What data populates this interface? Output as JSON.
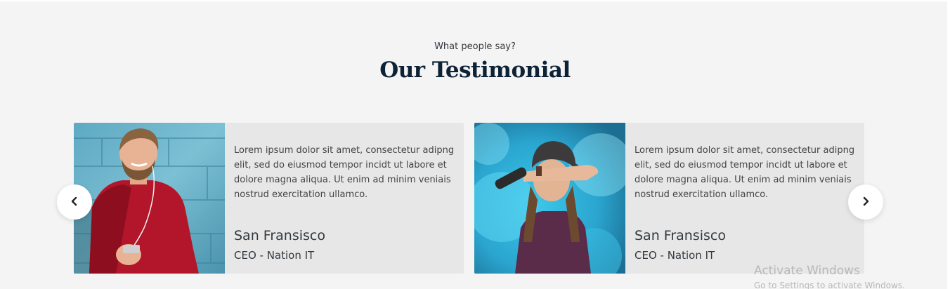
{
  "section": {
    "eyebrow": "What people say?",
    "title": "Our Testimonial"
  },
  "testimonials": [
    {
      "photo": "man-red-sweater-photo",
      "quote": "Lorem ipsum dolor sit amet, consectetur adipng elit, sed do eiusmod tempor incidt ut labore et dolore magna aliqua. Ut enim ad minim veniais nostrud exercitation ullamco.",
      "name": "San Fransisco",
      "role": "CEO - Nation IT"
    },
    {
      "photo": "woman-blue-smoke-photo",
      "quote": "Lorem ipsum dolor sit amet, consectetur adipng elit, sed do eiusmod tempor incidt ut labore et dolore magna aliqua. Ut enim ad minim veniais nostrud exercitation ullamco.",
      "name": "San Fransisco",
      "role": "CEO - Nation IT"
    }
  ],
  "carousel": {
    "prev_icon": "chevron-left-icon",
    "next_icon": "chevron-right-icon"
  },
  "watermark": {
    "line1": "Activate Windows",
    "line2": "Go to Settings to activate Windows."
  },
  "colors": {
    "background": "#f4f4f4",
    "card": "#e7e7e7",
    "heading": "#0e2236"
  }
}
